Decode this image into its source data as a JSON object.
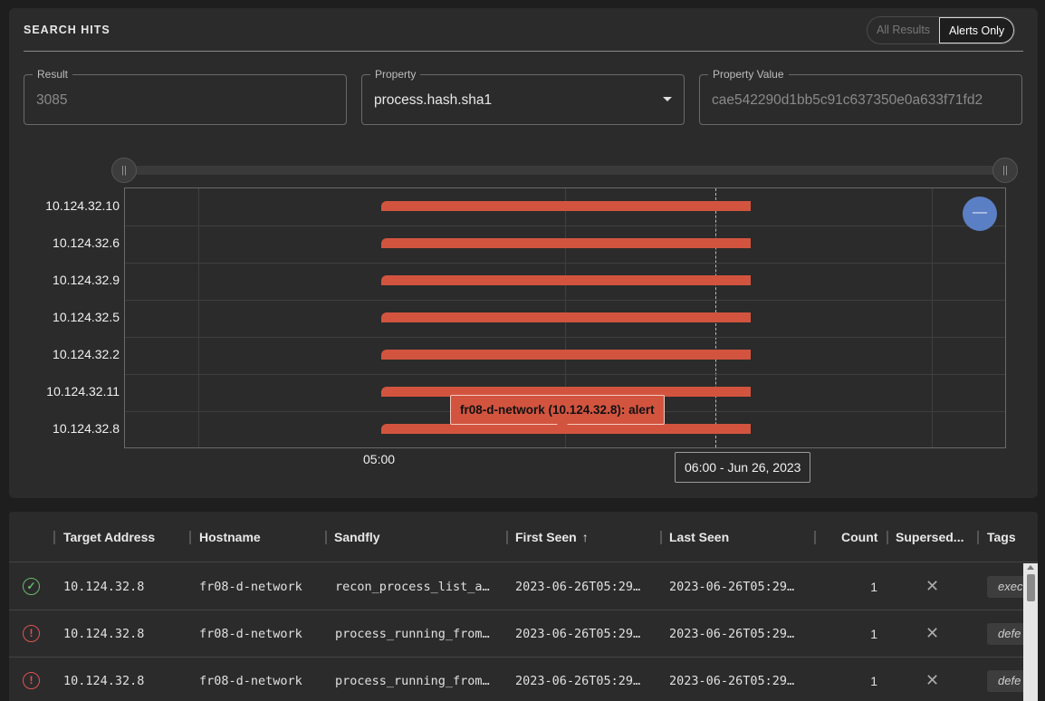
{
  "panel": {
    "title": "SEARCH HITS",
    "toggle": {
      "all_label": "All Results",
      "alerts_label": "Alerts Only",
      "selected": "Alerts Only"
    }
  },
  "fields": {
    "result": {
      "label": "Result",
      "value": "3085"
    },
    "property": {
      "label": "Property",
      "value": "process.hash.sha1"
    },
    "property_value": {
      "label": "Property Value",
      "value": "cae542290d1bb5c91c637350e0a633f71fd2"
    }
  },
  "slider": {
    "left_icon": "drag-handle-icon",
    "right_icon": "drag-handle-icon",
    "handle_glyph": "||"
  },
  "zoom": {
    "icon": "zoom-out-icon",
    "glyph": "—"
  },
  "chart_data": {
    "type": "bar",
    "categories": [
      "10.124.32.10",
      "10.124.32.6",
      "10.124.32.9",
      "10.124.32.5",
      "10.124.32.2",
      "10.124.32.11",
      "10.124.32.8"
    ],
    "x_ticks": [
      "05:00"
    ],
    "cursor_label": "06:00 - Jun 26, 2023",
    "tooltip": "fr08-d-network (10.124.32.8): alert",
    "bar_color": "#d2543f"
  },
  "table": {
    "columns": [
      "Target Address",
      "Hostname",
      "Sandfly",
      "First Seen",
      "Last Seen",
      "Count",
      "Supersed...",
      "Tags"
    ],
    "sort_icon": "arrow-up-icon",
    "sort_glyph": "↑",
    "rows": [
      {
        "status": "ok",
        "status_glyph": "✓",
        "target": "10.124.32.8",
        "hostname": "fr08-d-network",
        "sandfly": "recon_process_list_a…",
        "first_seen": "2023-06-26T05:29…",
        "last_seen": "2023-06-26T05:29…",
        "count": "1",
        "superseded_glyph": "✕",
        "tag": "exec"
      },
      {
        "status": "alert",
        "status_glyph": "!",
        "target": "10.124.32.8",
        "hostname": "fr08-d-network",
        "sandfly": "process_running_from…",
        "first_seen": "2023-06-26T05:29…",
        "last_seen": "2023-06-26T05:29…",
        "count": "1",
        "superseded_glyph": "✕",
        "tag": "defe"
      },
      {
        "status": "alert",
        "status_glyph": "!",
        "target": "10.124.32.8",
        "hostname": "fr08-d-network",
        "sandfly": "process_running_from…",
        "first_seen": "2023-06-26T05:29…",
        "last_seen": "2023-06-26T05:29…",
        "count": "1",
        "superseded_glyph": "✕",
        "tag": "defe"
      }
    ]
  }
}
